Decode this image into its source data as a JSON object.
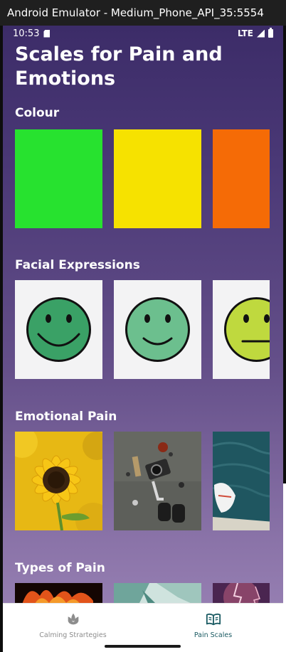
{
  "window": {
    "title": "Android Emulator - Medium_Phone_API_35:5554"
  },
  "status_bar": {
    "time": "10:53",
    "network": "LTE"
  },
  "page": {
    "title": "Scales for Pain and Emotions"
  },
  "sections": {
    "colour": {
      "title": "Colour",
      "tiles": [
        {
          "color": "#27e22f"
        },
        {
          "color": "#f6e200"
        },
        {
          "color": "#f56b06"
        }
      ]
    },
    "facial": {
      "title": "Facial Expressions",
      "tiles": [
        {
          "face_color": "#3aa166",
          "expression": "big-smile"
        },
        {
          "face_color": "#6cbf8e",
          "expression": "smile"
        },
        {
          "face_color": "#bfd93e",
          "expression": "neutral"
        }
      ]
    },
    "emotional": {
      "title": "Emotional Pain",
      "tiles": [
        {
          "subject": "sunflower"
        },
        {
          "subject": "floating-objects"
        },
        {
          "subject": "feet-over-water"
        }
      ]
    },
    "types": {
      "title": "Types of Pain",
      "tiles": [
        {
          "subject": "fire"
        },
        {
          "subject": "ice"
        },
        {
          "subject": "lightning"
        }
      ]
    }
  },
  "bottom_nav": {
    "items": [
      {
        "label": "Calming Strartegies",
        "icon": "lotus-icon",
        "active": false
      },
      {
        "label": "Pain Scales",
        "icon": "book-icon",
        "active": true
      }
    ]
  }
}
